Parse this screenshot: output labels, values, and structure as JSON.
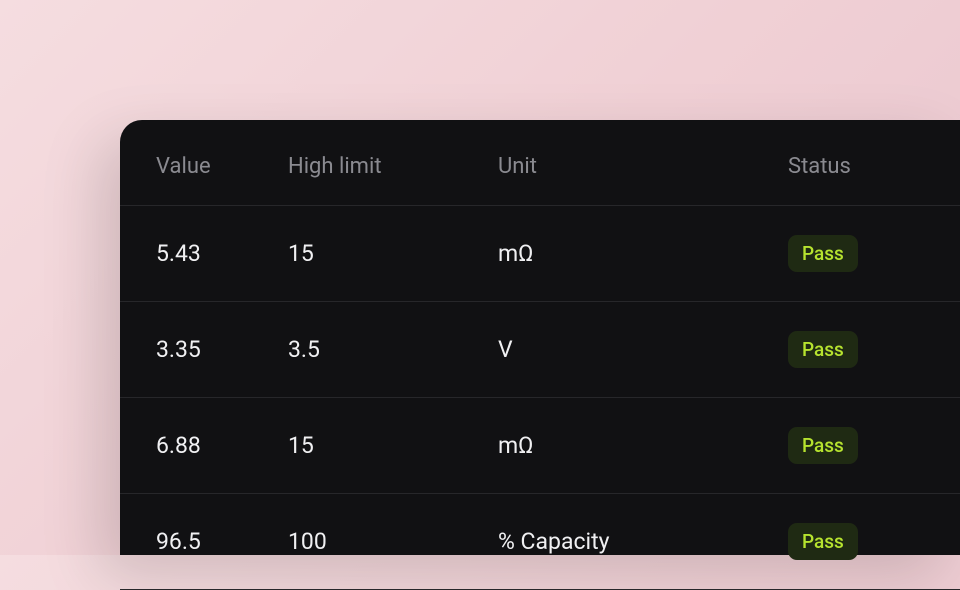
{
  "table": {
    "headers": {
      "value": "Value",
      "high_limit": "High limit",
      "unit": "Unit",
      "status": "Status"
    },
    "rows": [
      {
        "value": "5.43",
        "high_limit": "15",
        "unit": "mΩ",
        "status": "Pass"
      },
      {
        "value": "3.35",
        "high_limit": "3.5",
        "unit": "V",
        "status": "Pass"
      },
      {
        "value": "6.88",
        "high_limit": "15",
        "unit": "mΩ",
        "status": "Pass"
      },
      {
        "value": "96.5",
        "high_limit": "100",
        "unit": "% Capacity",
        "status": "Pass"
      }
    ]
  },
  "colors": {
    "badge_bg": "#1f2a13",
    "badge_text": "#b6e32f",
    "panel_bg": "#111113"
  }
}
